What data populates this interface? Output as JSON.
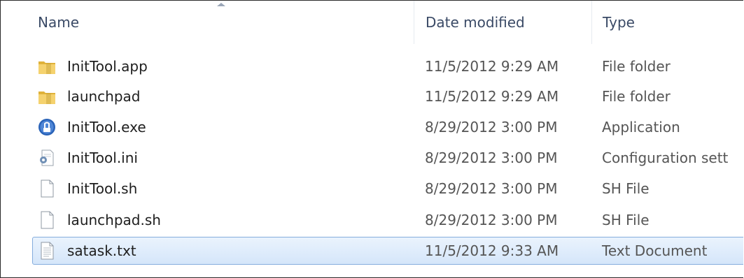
{
  "columns": {
    "name": "Name",
    "date": "Date modified",
    "type": "Type"
  },
  "files": [
    {
      "name": "InitTool.app",
      "date": "11/5/2012 9:29 AM",
      "type": "File folder",
      "icon": "folder-icon"
    },
    {
      "name": "launchpad",
      "date": "11/5/2012 9:29 AM",
      "type": "File folder",
      "icon": "folder-icon"
    },
    {
      "name": "InitTool.exe",
      "date": "8/29/2012 3:00 PM",
      "type": "Application",
      "icon": "application-icon"
    },
    {
      "name": "InitTool.ini",
      "date": "8/29/2012 3:00 PM",
      "type": "Configuration sett",
      "icon": "config-file-icon"
    },
    {
      "name": "InitTool.sh",
      "date": "8/29/2012 3:00 PM",
      "type": "SH File",
      "icon": "file-icon"
    },
    {
      "name": "launchpad.sh",
      "date": "8/29/2012 3:00 PM",
      "type": "SH File",
      "icon": "file-icon"
    },
    {
      "name": "satask.txt",
      "date": "11/5/2012 9:33 AM",
      "type": "Text Document",
      "icon": "text-file-icon",
      "selected": true
    }
  ],
  "colors": {
    "selection_border": "#84acdd",
    "selection_fill": "#d5e6fa",
    "folder_yellow": "#f2c94c",
    "app_blue": "#2a63b8"
  }
}
